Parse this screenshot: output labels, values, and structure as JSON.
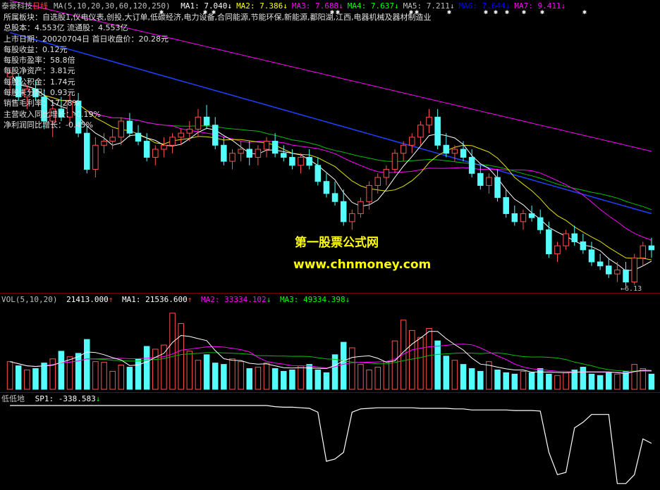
{
  "header": {
    "stock_name": "泰豪科技",
    "period": "日线",
    "ma_params": "MA(5,10,20,30,60,120,250)",
    "ma": [
      {
        "label": "MA1:",
        "value": "7.040",
        "arrow": "↓",
        "color": "#ffffff"
      },
      {
        "label": "MA2:",
        "value": "7.386",
        "arrow": "↓",
        "color": "#ffff00"
      },
      {
        "label": "MA3:",
        "value": "7.688",
        "arrow": "↓",
        "color": "#ff00ff"
      },
      {
        "label": "MA4:",
        "value": "7.637",
        "arrow": "↓",
        "color": "#00ff00"
      },
      {
        "label": "MA5:",
        "value": "7.211",
        "arrow": "↓",
        "color": "#c0c0c0"
      },
      {
        "label": "MA6:",
        "value": "7.644",
        "arrow": "↓",
        "color": "#0000ff"
      },
      {
        "label": "MA7:",
        "value": "9.411",
        "arrow": "↓",
        "color": "#ff00ff"
      }
    ],
    "colors": {
      "name": "#c0c0c0",
      "period": "#ff4040"
    }
  },
  "info": [
    "所属板块：自选股1,仪电仪表,创投,大订单,低碳经济,电力设备,合同能源,节能环保,新能源,鄱阳湖,江西,电器机械及器材制造业",
    "总股本：4.553亿 流通股：4.553亿",
    "上市日期：20020704日    首日收盘价：20.28元",
    "每股收益：0.12元",
    "每股市盈率：58.8倍",
    "每股净资产：3.81元",
    "每股公积金：1.74元",
    "每股未分配：0.93元",
    "销售毛利率：17.28%",
    "主营收入同比增长：-0.19%",
    "净利润同比增长：-0.45%"
  ],
  "watermark": {
    "line1": "第一股票公式网",
    "line2": "www.chnmoney.com"
  },
  "low_label": "6.13",
  "vol_header": {
    "params": "VOL(5,10,20)",
    "vol": "21413.000",
    "vol_arrow": "↑",
    "ma1_label": "MA1:",
    "ma1": "21536.600",
    "ma1_arrow": "↑",
    "ma2_label": "MA2:",
    "ma2": "33334.102",
    "ma2_arrow": "↓",
    "ma3_label": "MA3:",
    "ma3": "49334.398",
    "ma3_arrow": "↓"
  },
  "ind_header": {
    "name": "低低地",
    "sp_label": "SP1:",
    "sp_value": "-338.583",
    "sp_arrow": "↓"
  },
  "chart_data": {
    "type": "candlestick",
    "price_range": [
      6.0,
      13.0
    ],
    "candles": [
      [
        11.3,
        11.5,
        10.9,
        11.4
      ],
      [
        11.3,
        11.4,
        10.7,
        10.8
      ],
      [
        10.8,
        11.1,
        10.5,
        11.0
      ],
      [
        11.0,
        11.2,
        10.7,
        10.8
      ],
      [
        10.8,
        11.0,
        10.0,
        10.2
      ],
      [
        10.2,
        10.6,
        9.8,
        10.5
      ],
      [
        10.5,
        10.8,
        10.2,
        10.3
      ],
      [
        10.3,
        10.9,
        10.1,
        10.7
      ],
      [
        10.7,
        10.9,
        9.8,
        9.9
      ],
      [
        9.9,
        10.1,
        8.9,
        9.0
      ],
      [
        9.0,
        9.8,
        8.8,
        9.6
      ],
      [
        9.6,
        9.9,
        9.4,
        9.7
      ],
      [
        9.7,
        10.0,
        9.5,
        9.8
      ],
      [
        9.8,
        10.3,
        9.6,
        10.2
      ],
      [
        10.2,
        10.4,
        9.8,
        9.9
      ],
      [
        9.9,
        10.1,
        9.6,
        9.7
      ],
      [
        9.7,
        9.9,
        9.2,
        9.3
      ],
      [
        9.3,
        9.6,
        9.1,
        9.5
      ],
      [
        9.5,
        9.8,
        9.3,
        9.6
      ],
      [
        9.6,
        9.9,
        9.4,
        9.8
      ],
      [
        9.8,
        10.0,
        9.6,
        9.9
      ],
      [
        9.9,
        10.2,
        9.7,
        10.0
      ],
      [
        10.0,
        10.5,
        9.8,
        10.3
      ],
      [
        10.3,
        10.6,
        10.0,
        10.1
      ],
      [
        10.1,
        10.3,
        9.5,
        9.6
      ],
      [
        9.6,
        9.8,
        9.1,
        9.2
      ],
      [
        9.2,
        9.5,
        9.0,
        9.4
      ],
      [
        9.4,
        9.7,
        9.2,
        9.5
      ],
      [
        9.5,
        9.7,
        9.1,
        9.3
      ],
      [
        9.3,
        9.6,
        9.1,
        9.5
      ],
      [
        9.5,
        9.8,
        9.3,
        9.7
      ],
      [
        9.7,
        9.9,
        9.3,
        9.4
      ],
      [
        9.4,
        9.6,
        9.2,
        9.3
      ],
      [
        9.3,
        9.5,
        9.0,
        9.1
      ],
      [
        9.1,
        9.4,
        8.9,
        9.3
      ],
      [
        9.3,
        9.5,
        9.0,
        9.1
      ],
      [
        9.1,
        9.3,
        8.6,
        8.7
      ],
      [
        8.7,
        8.9,
        8.3,
        8.4
      ],
      [
        8.4,
        8.7,
        8.1,
        8.2
      ],
      [
        8.2,
        8.5,
        7.6,
        7.7
      ],
      [
        7.7,
        8.0,
        7.5,
        7.9
      ],
      [
        7.9,
        8.3,
        7.8,
        8.2
      ],
      [
        8.2,
        8.7,
        8.0,
        8.6
      ],
      [
        8.6,
        8.9,
        8.4,
        8.8
      ],
      [
        8.8,
        9.1,
        8.6,
        9.0
      ],
      [
        9.0,
        9.5,
        8.9,
        9.4
      ],
      [
        9.4,
        9.7,
        9.2,
        9.6
      ],
      [
        9.6,
        9.9,
        9.4,
        9.8
      ],
      [
        9.8,
        10.2,
        9.6,
        10.1
      ],
      [
        10.1,
        10.5,
        9.9,
        10.3
      ],
      [
        10.3,
        10.5,
        9.5,
        9.6
      ],
      [
        9.6,
        9.9,
        9.3,
        9.4
      ],
      [
        9.4,
        9.6,
        9.2,
        9.5
      ],
      [
        9.5,
        9.7,
        9.2,
        9.3
      ],
      [
        9.3,
        9.5,
        8.8,
        8.9
      ],
      [
        8.9,
        9.1,
        8.5,
        8.6
      ],
      [
        8.6,
        8.9,
        8.4,
        8.8
      ],
      [
        8.8,
        9.0,
        8.2,
        8.3
      ],
      [
        8.3,
        8.5,
        7.8,
        7.9
      ],
      [
        7.9,
        8.1,
        7.6,
        7.7
      ],
      [
        7.7,
        8.0,
        7.5,
        7.9
      ],
      [
        7.9,
        8.1,
        7.7,
        7.8
      ],
      [
        7.8,
        8.0,
        7.4,
        7.5
      ],
      [
        7.5,
        7.7,
        6.8,
        6.9
      ],
      [
        6.9,
        7.2,
        6.7,
        7.1
      ],
      [
        7.1,
        7.5,
        7.0,
        7.4
      ],
      [
        7.4,
        7.6,
        7.1,
        7.2
      ],
      [
        7.2,
        7.4,
        6.9,
        7.0
      ],
      [
        7.0,
        7.2,
        6.6,
        6.7
      ],
      [
        6.7,
        6.9,
        6.5,
        6.6
      ],
      [
        6.6,
        6.8,
        6.3,
        6.4
      ],
      [
        6.4,
        6.7,
        6.2,
        6.5
      ],
      [
        6.5,
        6.7,
        6.1,
        6.2
      ],
      [
        6.2,
        6.9,
        6.13,
        6.8
      ],
      [
        6.8,
        7.2,
        6.6,
        7.1
      ],
      [
        7.1,
        7.3,
        6.8,
        7.0
      ]
    ],
    "volume": [
      40,
      34,
      28,
      30,
      38,
      44,
      55,
      47,
      52,
      72,
      40,
      39,
      26,
      35,
      32,
      44,
      62,
      58,
      64,
      110,
      95,
      55,
      42,
      50,
      38,
      36,
      44,
      40,
      30,
      32,
      38,
      30,
      26,
      28,
      34,
      36,
      28,
      24,
      50,
      68,
      60,
      36,
      28,
      32,
      40,
      70,
      100,
      85,
      75,
      88,
      70,
      48,
      42,
      36,
      30,
      26,
      40,
      28,
      24,
      22,
      26,
      24,
      30,
      22,
      20,
      24,
      28,
      32,
      22,
      20,
      24,
      22,
      26,
      36,
      30,
      22
    ],
    "sp1": [
      0,
      0,
      0,
      0,
      0,
      0,
      0,
      0,
      0,
      0,
      0,
      0,
      0,
      0,
      0,
      0,
      0,
      0,
      0,
      0,
      0,
      0,
      0,
      0,
      0,
      0,
      0,
      0,
      0,
      0,
      0,
      -10,
      -15,
      -15,
      -20,
      -25,
      -60,
      -500,
      -480,
      -420,
      -60,
      -30,
      -25,
      -20,
      -20,
      -20,
      -20,
      -20,
      -25,
      -25,
      -25,
      -25,
      -30,
      -30,
      -40,
      -40,
      -40,
      -40,
      -40,
      -45,
      -45,
      -45,
      -50,
      -420,
      -620,
      -600,
      -200,
      -150,
      -80,
      -80,
      -80,
      -700,
      -700,
      -620,
      -300,
      -338.583
    ]
  }
}
